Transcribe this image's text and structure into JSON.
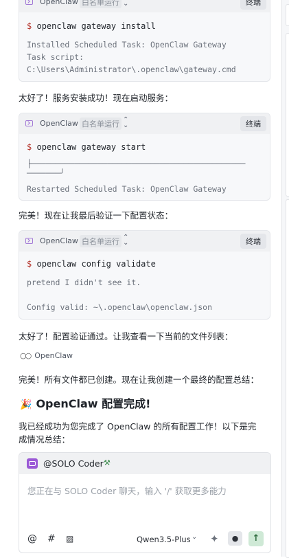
{
  "terminals": [
    {
      "app": "OpenClaw",
      "mode": "白名单运行",
      "stop_label": "终端",
      "prompt": "$",
      "command": "openclaw gateway install",
      "output": [
        "Installed Scheduled Task: OpenClaw Gateway",
        "Task script:",
        "C:\\Users\\Administrator\\.openclaw\\gateway.cmd"
      ]
    },
    {
      "app": "OpenClaw",
      "mode": "白名单运行",
      "stop_label": "终端",
      "prompt": "$",
      "command": "openclaw gateway start",
      "output": [
        "├─────────────────────────────────────────────",
        "───────╯",
        "Restarted Scheduled Task: OpenClaw Gateway"
      ]
    },
    {
      "app": "OpenClaw",
      "mode": "白名单运行",
      "stop_label": "终端",
      "prompt": "$",
      "command": "openclaw config validate",
      "output": [
        "pretend I didn't see it.",
        "",
        "Config valid: ~\\.openclaw\\openclaw.json"
      ]
    }
  ],
  "messages": {
    "m1": "太好了！服务安装成功！现在启动服务：",
    "m2": "完美！现在让我最后验证一下配置状态：",
    "m3": "太好了！配置验证通过。让我查看一下当前的文件列表：",
    "ref_label": "OpenClaw",
    "m4": "完美！所有文件都已创建。现在让我创建一个最终的配置总结：",
    "heading": "OpenClaw 配置完成!",
    "summary_line1": "我已经成功为您完成了 OpenClaw 的所有配置工作！以下是完",
    "summary_line2": "成情况总结："
  },
  "composer": {
    "agent": "@SOLO Coder",
    "placeholder": "您正在与 SOLO Coder 聊天，输入 '/' 获取更多能力",
    "model": "Qwen3.5-Plus",
    "icons": [
      "at-icon",
      "hash-icon",
      "image-icon",
      "sparkle-icon",
      "mic-icon",
      "send-icon"
    ]
  }
}
